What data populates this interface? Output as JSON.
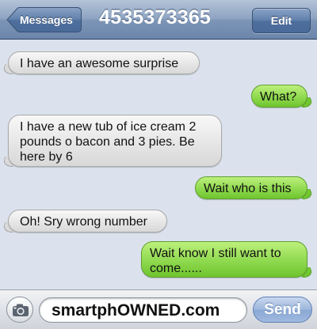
{
  "navbar": {
    "back_label": "Messages",
    "title": "4535373365",
    "edit_label": "Edit"
  },
  "messages": [
    {
      "direction": "incoming",
      "text": "I have an awesome surprise"
    },
    {
      "direction": "outgoing",
      "text": "What?"
    },
    {
      "direction": "incoming",
      "text": "I have a new tub of ice cream 2 pounds o bacon and 3 pies. Be here by 6"
    },
    {
      "direction": "outgoing",
      "text": "Wait who is this"
    },
    {
      "direction": "incoming",
      "text": "Oh! Sry wrong number"
    },
    {
      "direction": "outgoing",
      "text": "Wait know I still want to come......"
    }
  ],
  "input": {
    "value": "smartphOWNED.com",
    "send_label": "Send",
    "camera_icon": "camera-icon"
  },
  "colors": {
    "incoming_bubble": "#e6e6e6",
    "outgoing_bubble": "#8fd94f",
    "navbar": "#7d95b6",
    "background": "#dbe2ed"
  }
}
